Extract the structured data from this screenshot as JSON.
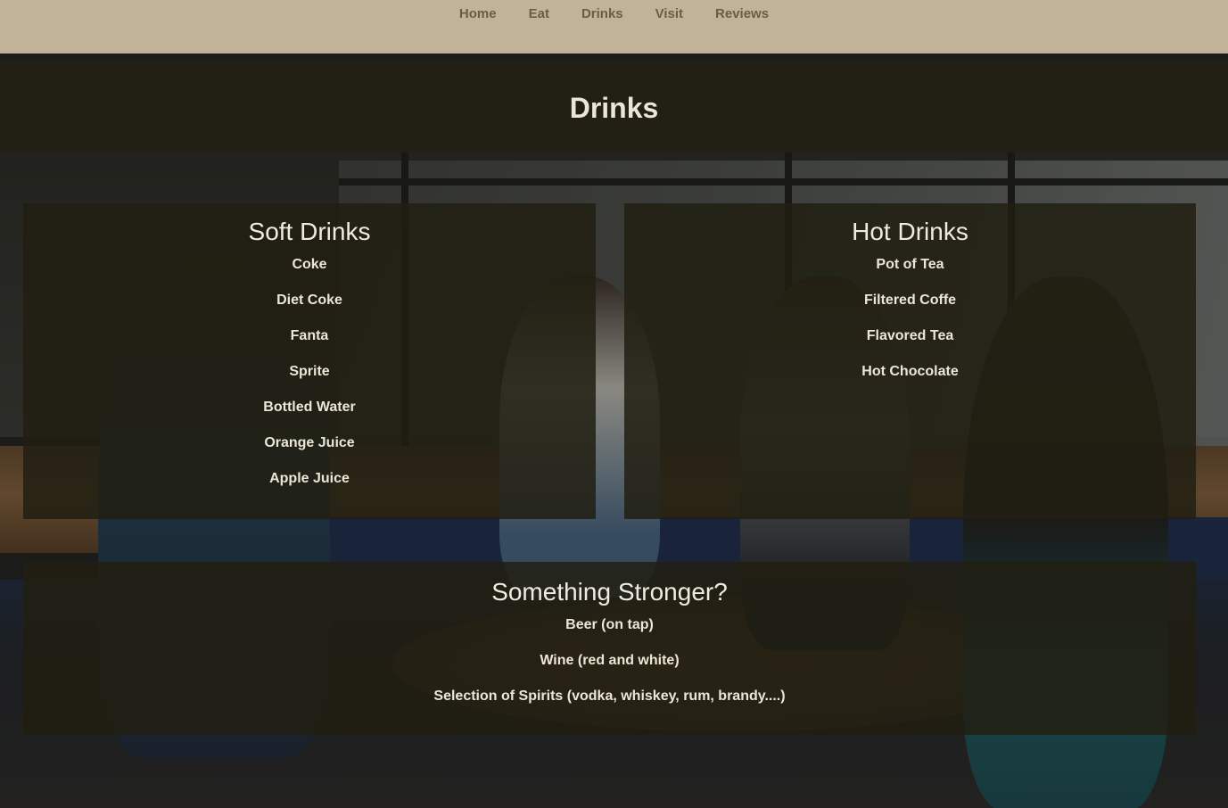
{
  "nav": {
    "items": [
      {
        "label": "Home"
      },
      {
        "label": "Eat"
      },
      {
        "label": "Drinks"
      },
      {
        "label": "Visit"
      },
      {
        "label": "Reviews"
      }
    ]
  },
  "page": {
    "title": "Drinks"
  },
  "soft_drinks": {
    "heading": "Soft Drinks",
    "items": [
      "Coke",
      "Diet Coke",
      "Fanta",
      "Sprite",
      "Bottled Water",
      "Orange Juice",
      "Apple Juice"
    ]
  },
  "hot_drinks": {
    "heading": "Hot Drinks",
    "items": [
      "Pot of Tea",
      "Filtered Coffe",
      "Flavored Tea",
      "Hot Chocolate"
    ]
  },
  "stronger": {
    "heading": "Something Stronger?",
    "items": [
      "Beer (on tap)",
      "Wine (red and white)",
      "Selection of Spirits (vodka, whiskey, rum, brandy....)"
    ]
  },
  "colors": {
    "nav_bg": "#c0b39a",
    "nav_text": "#6b5e3e",
    "panel_bg": "#211e12",
    "text": "#ece6d6"
  }
}
